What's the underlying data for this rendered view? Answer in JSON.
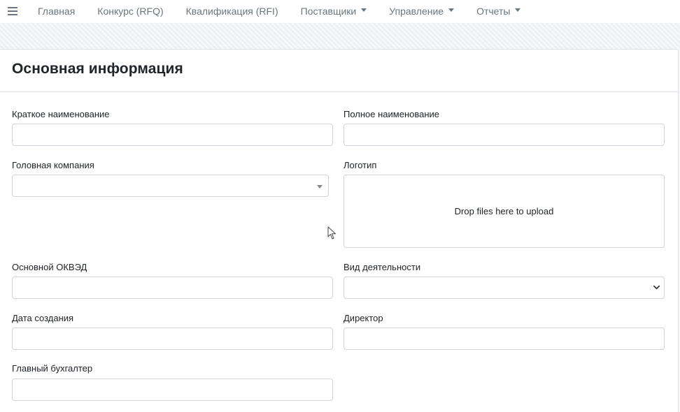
{
  "navbar": {
    "menu_icon": "hamburger-menu-icon",
    "items": [
      {
        "label": "Главная",
        "dropdown": false
      },
      {
        "label": "Конкурс (RFQ)",
        "dropdown": false
      },
      {
        "label": "Квалификация (RFI)",
        "dropdown": false
      },
      {
        "label": "Поставщики",
        "dropdown": true
      },
      {
        "label": "Управление",
        "dropdown": true
      },
      {
        "label": "Отчеты",
        "dropdown": true
      }
    ]
  },
  "card": {
    "title": "Основная информация"
  },
  "form": {
    "short_name": {
      "label": "Краткое наименование",
      "value": ""
    },
    "full_name": {
      "label": "Полное наименование",
      "value": ""
    },
    "parent_company": {
      "label": "Головная компания",
      "value": ""
    },
    "logo": {
      "label": "Логотип",
      "dropzone_text": "Drop files here to upload"
    },
    "okved": {
      "label": "Основной ОКВЭД",
      "value": ""
    },
    "activity": {
      "label": "Вид деятельности",
      "value": ""
    },
    "created_date": {
      "label": "Дата создания",
      "value": ""
    },
    "director": {
      "label": "Директор",
      "value": ""
    },
    "chief_accountant": {
      "label": "Главный бухгалтер",
      "value": ""
    }
  },
  "colors": {
    "navbar_bg": "#ffffff",
    "nav_text": "#6c757d",
    "border": "#ced4da",
    "card_bg": "#ffffff",
    "page_bg": "#f4f6f9"
  }
}
